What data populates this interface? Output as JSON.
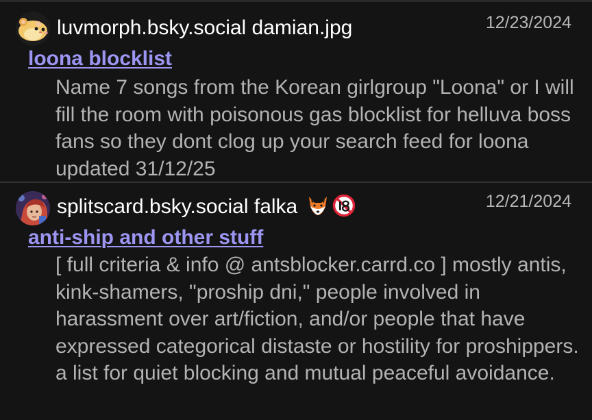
{
  "feed": {
    "items": [
      {
        "avatar": "hamster-avatar",
        "author": "luvmorph.bsky.social damian.jpg",
        "date": "12/23/2024",
        "title": "loona blocklist",
        "description": "Name 7 songs from the Korean girlgroup \"Loona\" or I will fill the room with poisonous gas blocklist for helluva boss fans so they dont clog up your search feed for loona updated 31/12/25"
      },
      {
        "avatar": "character-avatar",
        "author": "splitscard.bsky.social falka",
        "author_emojis": [
          "fox-emoji",
          "no-under-18-emoji"
        ],
        "date": "12/21/2024",
        "title": "anti-ship and other stuff",
        "description": "[ full criteria & info @ antsblocker.carrd.co ] mostly antis, kink-shamers, \"proship dni,\" people involved in harassment over art/fiction, and/or people that have expressed categorical distaste or hostility for proshippers. a list for quiet blocking and mutual peaceful avoidance."
      }
    ]
  },
  "colors": {
    "background": "#141414",
    "link": "#9c96f2",
    "description": "#b3b3b3",
    "date": "#b7b7b7",
    "divider": "#333333"
  }
}
